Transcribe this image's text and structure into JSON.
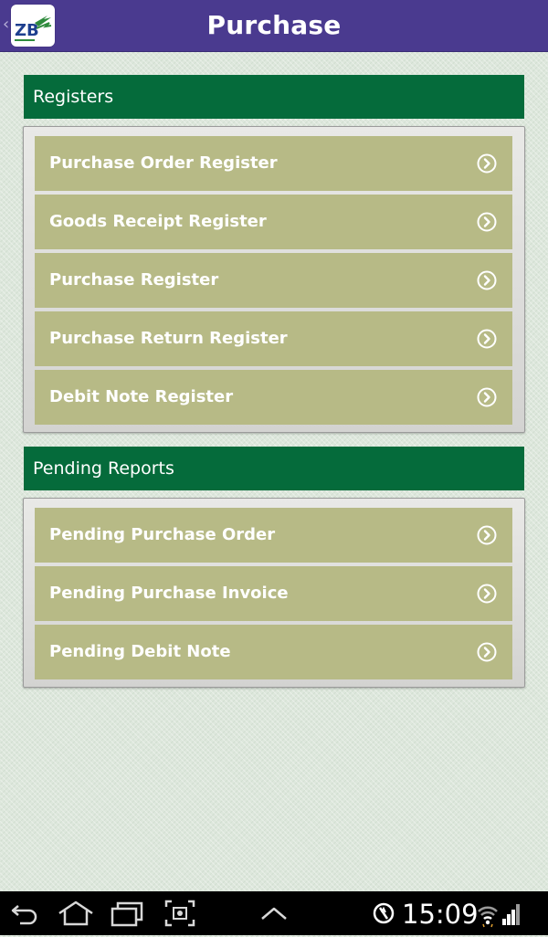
{
  "header": {
    "title": "Purchase",
    "logo_text": "ZB",
    "up_icon": "chevron-left-icon",
    "colors": {
      "background": "#4a3a8f",
      "title": "#ffffff"
    }
  },
  "sections": [
    {
      "title": "Registers",
      "items": [
        {
          "label": "Purchase Order Register",
          "icon": "circle-chevron-right-icon"
        },
        {
          "label": "Goods Receipt Register",
          "icon": "circle-chevron-right-icon"
        },
        {
          "label": "Purchase Register",
          "icon": "circle-chevron-right-icon"
        },
        {
          "label": "Purchase Return Register",
          "icon": "circle-chevron-right-icon"
        },
        {
          "label": "Debit Note Register",
          "icon": "circle-chevron-right-icon"
        }
      ]
    },
    {
      "title": "Pending Reports",
      "items": [
        {
          "label": "Pending Purchase Order",
          "icon": "circle-chevron-right-icon"
        },
        {
          "label": "Pending Purchase Invoice",
          "icon": "circle-chevron-right-icon"
        },
        {
          "label": "Pending Debit Note",
          "icon": "circle-chevron-right-icon"
        }
      ]
    }
  ],
  "colors": {
    "section_header": "#056b3b",
    "menu_item": "#b7ba86",
    "page_background": "#dde7dc"
  },
  "system_bar": {
    "time": "15:09",
    "nav_icons": [
      "back-icon",
      "home-icon",
      "recent-apps-icon",
      "screenshot-icon",
      "menu-up-icon"
    ],
    "status_icons": [
      "no-sync-icon",
      "wifi-icon",
      "signal-icon"
    ]
  }
}
